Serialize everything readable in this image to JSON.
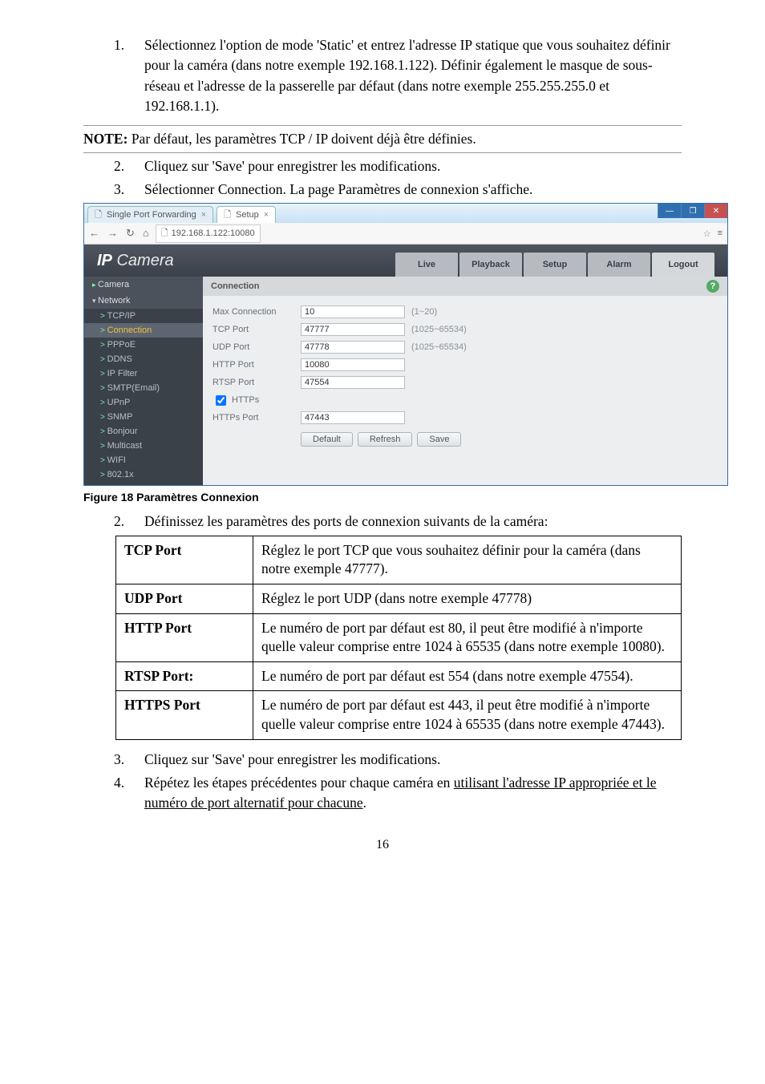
{
  "step1": {
    "num": "1.",
    "text": "Sélectionnez l'option de mode 'Static' et entrez l'adresse IP statique que vous souhaitez définir pour la caméra (dans notre exemple 192.168.1.122). Définir également le masque de sous-réseau et l'adresse de la passerelle par défaut (dans notre exemple 255.255.255.0 et 192.168.1.1)."
  },
  "note": {
    "label": "NOTE:",
    "text": " Par défaut, les paramètres TCP / IP doivent déjà être définies."
  },
  "step2": {
    "num": "2.",
    "text": "Cliquez sur 'Save' pour enregistrer les modifications."
  },
  "step3": {
    "num": "3.",
    "text": "Sélectionner Connection. La page Paramètres de connexion s'affiche."
  },
  "shot": {
    "tabs": {
      "a": "Single Port Forwarding",
      "b": "Setup"
    },
    "url": "192.168.1.122:10080",
    "brand": {
      "a": "IP",
      "b": " Camera"
    },
    "top": {
      "live": "Live",
      "playback": "Playback",
      "setup": "Setup",
      "alarm": "Alarm",
      "logout": "Logout"
    },
    "side": {
      "camera": "Camera",
      "network": "Network",
      "tcpip": "TCP/IP",
      "connection": "Connection",
      "pppoe": "PPPoE",
      "ddns": "DDNS",
      "ipfilter": "IP Filter",
      "smtp": "SMTP(Email)",
      "upnp": "UPnP",
      "snmp": "SNMP",
      "bonjour": "Bonjour",
      "multicast": "Multicast",
      "wifi": "WIFI",
      "dot1x": "802.1x"
    },
    "panel": {
      "title": "Connection",
      "rows": {
        "maxconn": {
          "label": "Max Connection",
          "value": "10",
          "hint": "(1~20)"
        },
        "tcp": {
          "label": "TCP Port",
          "value": "47777",
          "hint": "(1025~65534)"
        },
        "udp": {
          "label": "UDP Port",
          "value": "47778",
          "hint": "(1025~65534)"
        },
        "http": {
          "label": "HTTP Port",
          "value": "10080",
          "hint": ""
        },
        "rtsp": {
          "label": "RTSP Port",
          "value": "47554",
          "hint": ""
        },
        "httpschk": {
          "label": "HTTPs"
        },
        "https": {
          "label": "HTTPs Port",
          "value": "47443",
          "hint": ""
        }
      },
      "btns": {
        "default": "Default",
        "refresh": "Refresh",
        "save": "Save"
      }
    }
  },
  "figcap": "Figure 18 Paramètres Connexion",
  "step4": {
    "num": "2.",
    "text": "Définissez les paramètres des ports de connexion suivants de la caméra:"
  },
  "table": {
    "tcp": {
      "k": "TCP Port",
      "v": "Réglez le port TCP que vous souhaitez définir pour la caméra (dans notre exemple 47777)."
    },
    "udp": {
      "k": "UDP Port",
      "v": "Réglez le port UDP (dans notre exemple 47778)"
    },
    "http": {
      "k": "HTTP Port",
      "v": "Le numéro de port par défaut est 80, il peut être modifié à n'importe quelle valeur comprise entre 1024 à 65535 (dans notre exemple 10080)."
    },
    "rtsp": {
      "k": "RTSP Port:",
      "v": "Le numéro de port par défaut est 554 (dans notre exemple 47554)."
    },
    "https": {
      "k": "HTTPS Port",
      "v": "Le numéro de port par défaut est 443, il peut être modifié à n'importe quelle valeur comprise entre 1024 à 65535 (dans notre exemple 47443)."
    }
  },
  "step5": {
    "num": "3.",
    "text": "Cliquez sur 'Save' pour enregistrer les modifications."
  },
  "step6": {
    "num": "4.",
    "text_a": "Répétez les étapes précédentes pour chaque caméra en ",
    "text_u": "utilisant l'adresse IP appropriée et le numéro de port alternatif pour chacune",
    "text_b": "."
  },
  "pagenum": "16"
}
